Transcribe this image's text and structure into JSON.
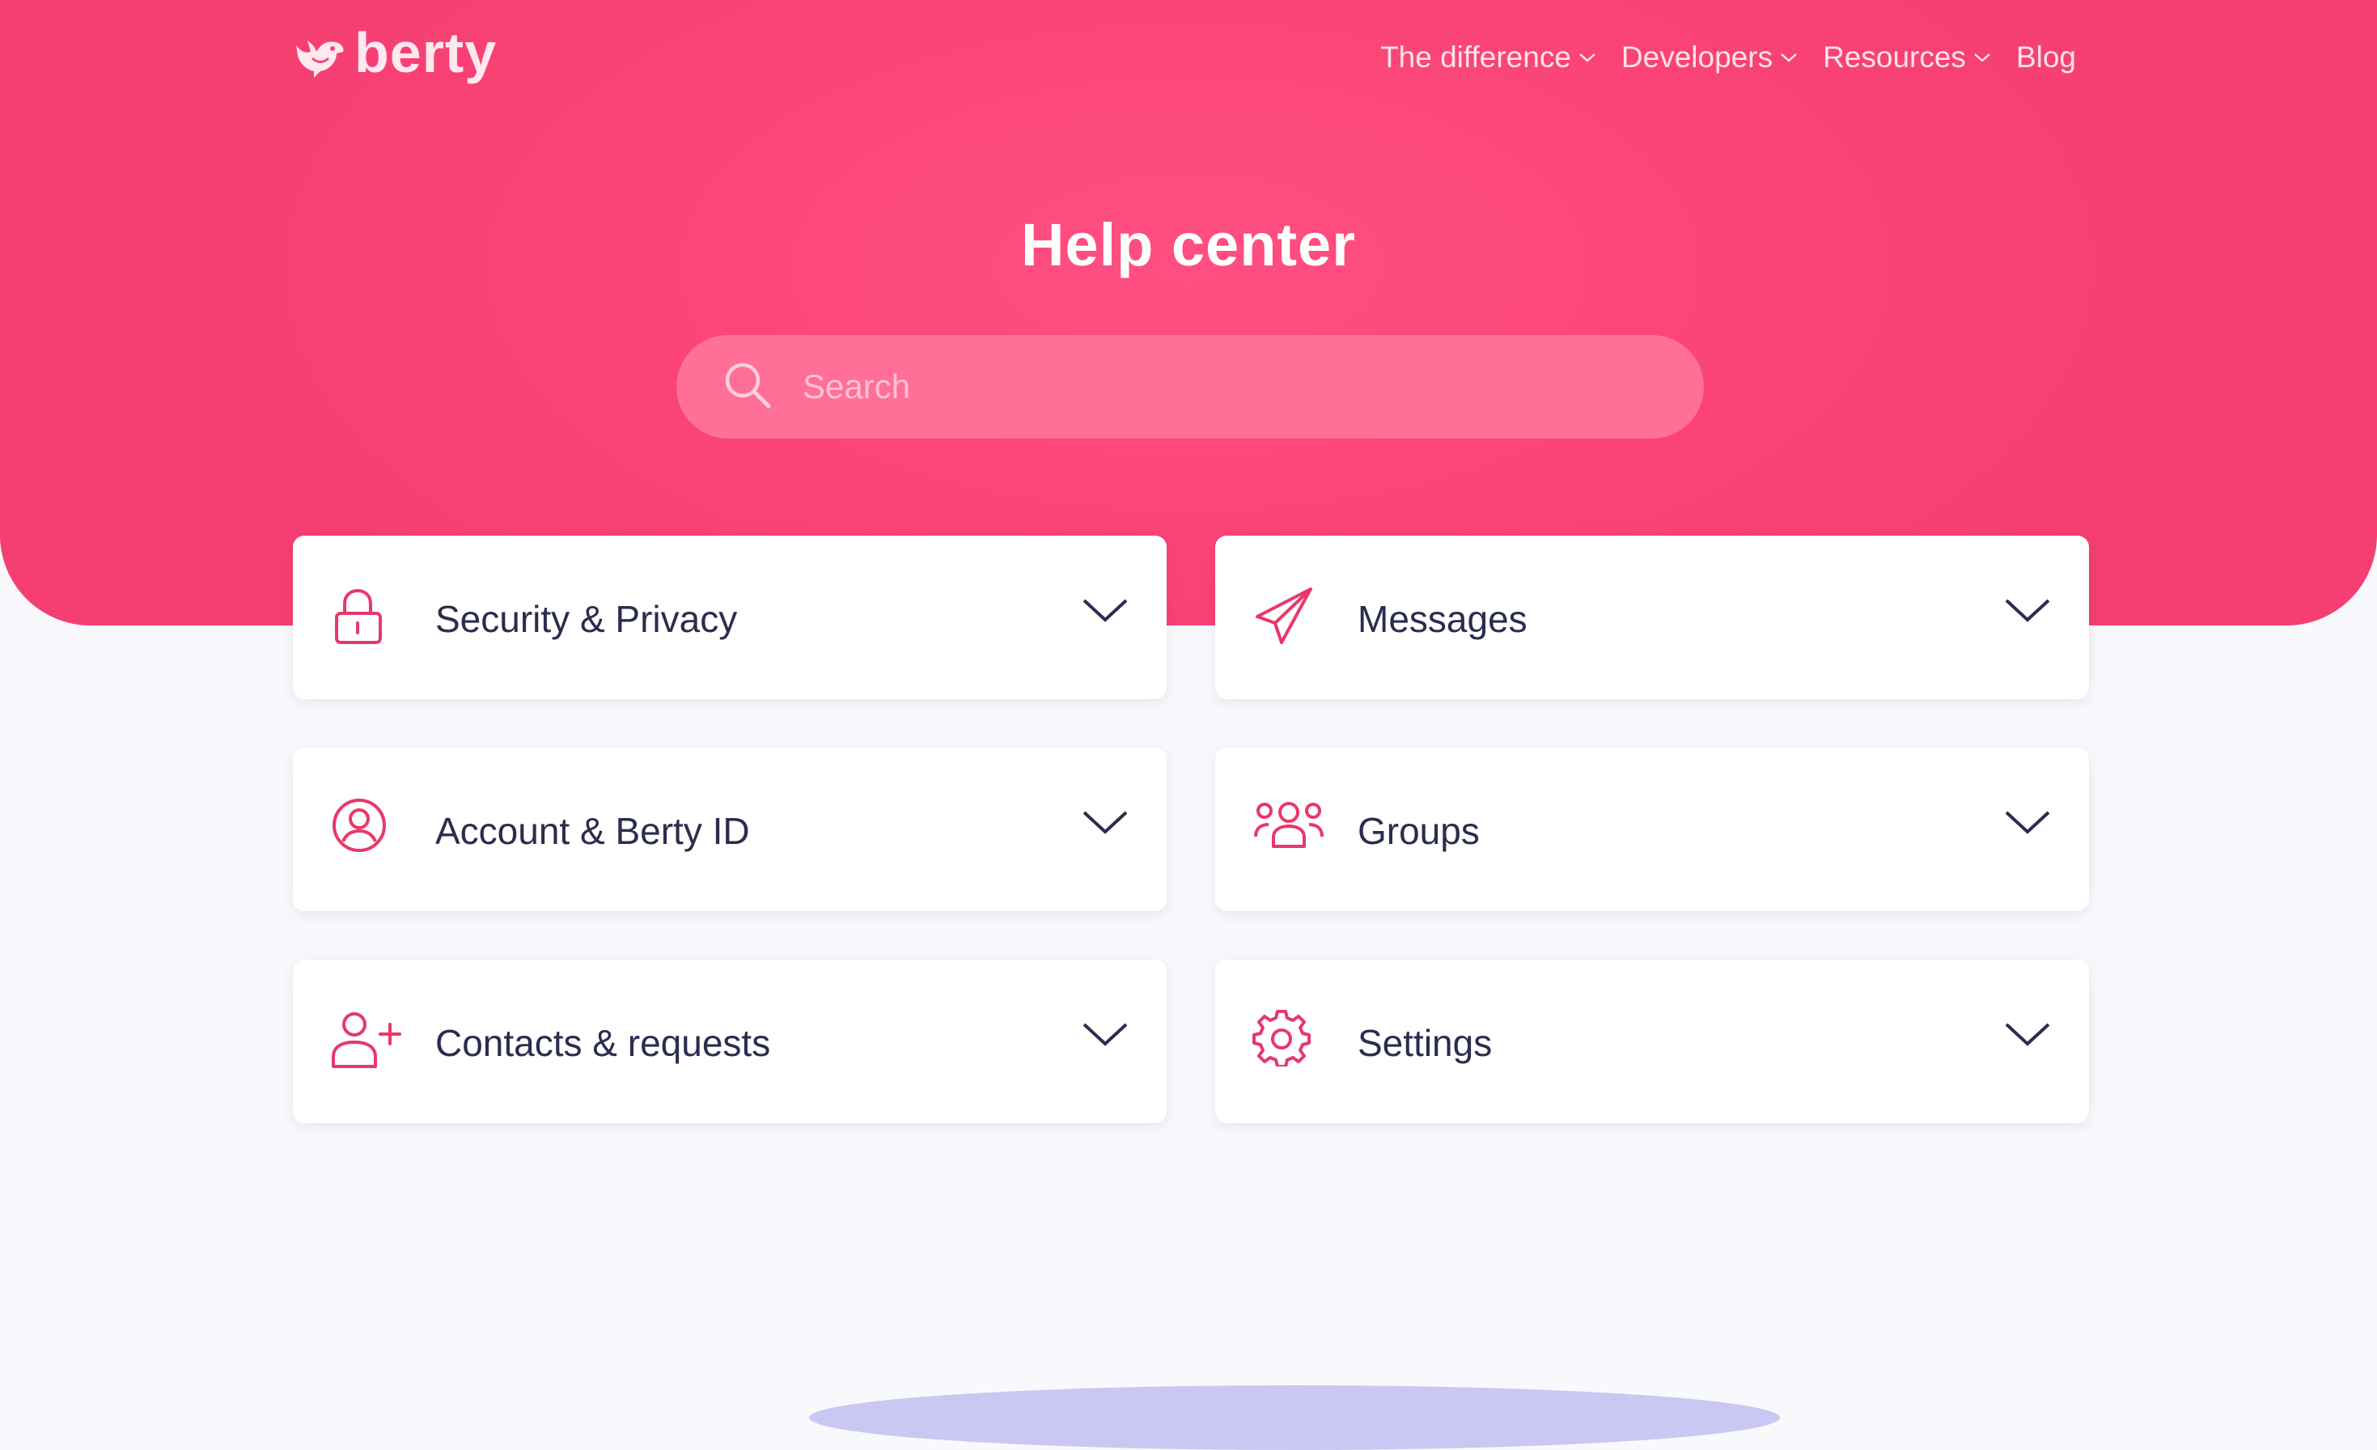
{
  "brand": {
    "name": "berty",
    "accent_color": "#fa4476",
    "logo_icon": "bird-logo-icon"
  },
  "nav": {
    "items": [
      {
        "label": "The difference",
        "has_dropdown": true
      },
      {
        "label": "Developers",
        "has_dropdown": true
      },
      {
        "label": "Resources",
        "has_dropdown": true
      },
      {
        "label": "Blog",
        "has_dropdown": false
      }
    ]
  },
  "hero": {
    "title": "Help center"
  },
  "search": {
    "placeholder": "Search",
    "value": "",
    "icon": "search-icon"
  },
  "categories": [
    {
      "label": "Security & Privacy",
      "icon": "lock-icon"
    },
    {
      "label": "Messages",
      "icon": "paper-plane-icon"
    },
    {
      "label": "Account & Berty ID",
      "icon": "user-circle-icon"
    },
    {
      "label": "Groups",
      "icon": "users-group-icon"
    },
    {
      "label": "Contacts & requests",
      "icon": "add-user-icon"
    },
    {
      "label": "Settings",
      "icon": "gear-icon"
    }
  ],
  "colors": {
    "text_dark": "#2a2d4e",
    "icon_accent": "#e8386b",
    "page_background": "#f9f9fd"
  }
}
